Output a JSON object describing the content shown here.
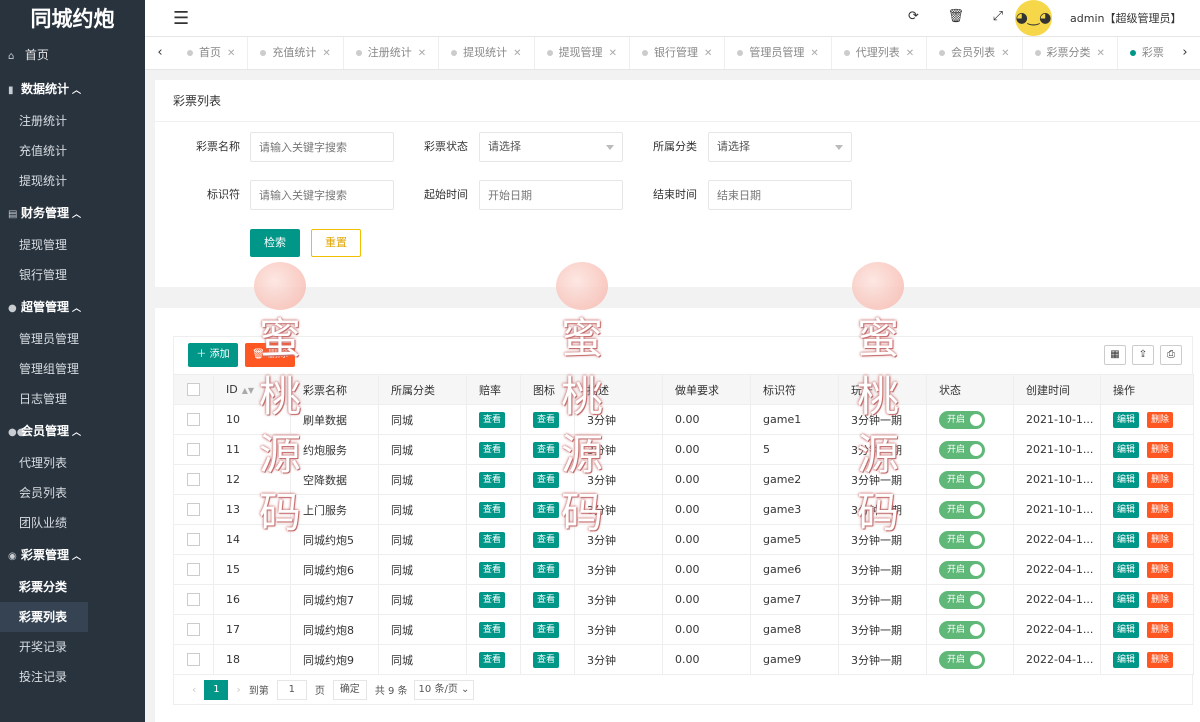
{
  "app": {
    "logo": "同城约炮"
  },
  "sidebar": {
    "home": "首页",
    "groups": [
      {
        "label": "数据统计",
        "items": [
          "注册统计",
          "充值统计",
          "提现统计"
        ]
      },
      {
        "label": "财务管理",
        "items": [
          "提现管理",
          "银行管理"
        ]
      },
      {
        "label": "超管管理",
        "items": [
          "管理员管理",
          "管理组管理",
          "日志管理"
        ]
      },
      {
        "label": "会员管理",
        "items": [
          "代理列表",
          "会员列表",
          "团队业绩"
        ]
      },
      {
        "label": "彩票管理",
        "items": [
          "彩票分类",
          "彩票列表",
          "开奖记录",
          "投注记录"
        ]
      }
    ]
  },
  "header": {
    "fold_icon": "menu-fold-icon",
    "icons": [
      "refresh-icon",
      "trash-icon",
      "fullscreen-icon"
    ],
    "user": "admin【超级管理员】"
  },
  "tabs": [
    "首页",
    "充值统计",
    "注册统计",
    "提现统计",
    "提现管理",
    "银行管理",
    "管理员管理",
    "代理列表",
    "会员列表",
    "彩票分类",
    "彩票"
  ],
  "search": {
    "title": "彩票列表",
    "name_label": "彩票名称",
    "name_placeholder": "请输入关键字搜索",
    "status_label": "彩票状态",
    "status_value": "请选择",
    "category_label": "所属分类",
    "category_value": "请选择",
    "key_label": "标识符",
    "key_placeholder": "请输入关键字搜索",
    "start_label": "起始时间",
    "start_placeholder": "开始日期",
    "end_label": "结束时间",
    "end_placeholder": "结束日期",
    "search_btn": "检索",
    "reset_btn": "重置"
  },
  "toolbar": {
    "add": "添加",
    "delete": "删除"
  },
  "table": {
    "columns": [
      "ID",
      "彩票名称",
      "所属分类",
      "赔率",
      "图标",
      "描述",
      "做单要求",
      "标识符",
      "玩法",
      "状态",
      "创建时间",
      "操作"
    ],
    "view_label": "查看",
    "switch_label": "开启",
    "edit_label": "编辑",
    "del_label": "删除",
    "rows": [
      {
        "id": "10",
        "name": "刷单数据",
        "cat": "同城",
        "desc": "3分钟",
        "req": "0.00",
        "key": "game1",
        "play": "3分钟一期",
        "time": "2021-10-1..."
      },
      {
        "id": "11",
        "name": "约炮服务",
        "cat": "同城",
        "desc": "3分钟",
        "req": "0.00",
        "key": "5",
        "play": "3分钟一期",
        "time": "2021-10-1..."
      },
      {
        "id": "12",
        "name": "空降数据",
        "cat": "同城",
        "desc": "3分钟",
        "req": "0.00",
        "key": "game2",
        "play": "3分钟一期",
        "time": "2021-10-1..."
      },
      {
        "id": "13",
        "name": "上门服务",
        "cat": "同城",
        "desc": "3分钟",
        "req": "0.00",
        "key": "game3",
        "play": "3分钟一期",
        "time": "2021-10-1..."
      },
      {
        "id": "14",
        "name": "同城约炮5",
        "cat": "同城",
        "desc": "3分钟",
        "req": "0.00",
        "key": "game5",
        "play": "3分钟一期",
        "time": "2022-04-1..."
      },
      {
        "id": "15",
        "name": "同城约炮6",
        "cat": "同城",
        "desc": "3分钟",
        "req": "0.00",
        "key": "game6",
        "play": "3分钟一期",
        "time": "2022-04-1..."
      },
      {
        "id": "16",
        "name": "同城约炮7",
        "cat": "同城",
        "desc": "3分钟",
        "req": "0.00",
        "key": "game7",
        "play": "3分钟一期",
        "time": "2022-04-1..."
      },
      {
        "id": "17",
        "name": "同城约炮8",
        "cat": "同城",
        "desc": "3分钟",
        "req": "0.00",
        "key": "game8",
        "play": "3分钟一期",
        "time": "2022-04-1..."
      },
      {
        "id": "18",
        "name": "同城约炮9",
        "cat": "同城",
        "desc": "3分钟",
        "req": "0.00",
        "key": "game9",
        "play": "3分钟一期",
        "time": "2022-04-1..."
      }
    ]
  },
  "pager": {
    "current": "1",
    "goto_label": "到第",
    "page_value": "1",
    "page_unit": "页",
    "confirm": "确定",
    "total": "共 9 条",
    "size": "10 条/页"
  },
  "watermark": {
    "chars": [
      "蜜",
      "桃",
      "源",
      "码"
    ]
  },
  "colors": {
    "primary": "#009688",
    "danger": "#ff5722",
    "sidebar": "#28333e",
    "switch": "#5fb878"
  }
}
